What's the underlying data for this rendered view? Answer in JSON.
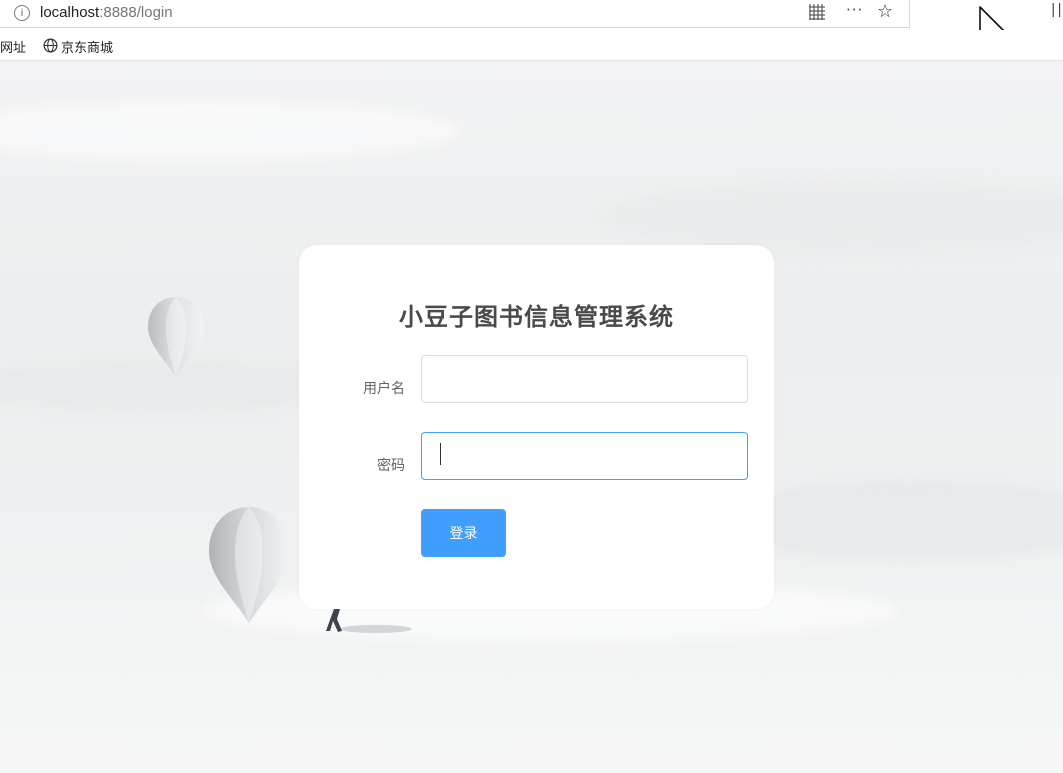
{
  "browser": {
    "url_host": "localhost",
    "url_rest": ":8888/login",
    "info_icon": "info-icon",
    "more_label": "···",
    "star_icon": "star-icon"
  },
  "bookmarks": {
    "items": [
      {
        "label": "网址"
      },
      {
        "label": "京东商城",
        "icon": "globe-icon"
      }
    ]
  },
  "login": {
    "title": "小豆子图书信息管理系统",
    "username_label": "用户名",
    "username_value": "",
    "password_label": "密码",
    "password_value": "",
    "submit_label": "登录"
  },
  "colors": {
    "primary": "#409eff",
    "input_border": "#dcdfe6",
    "title": "#4a4a4a"
  }
}
